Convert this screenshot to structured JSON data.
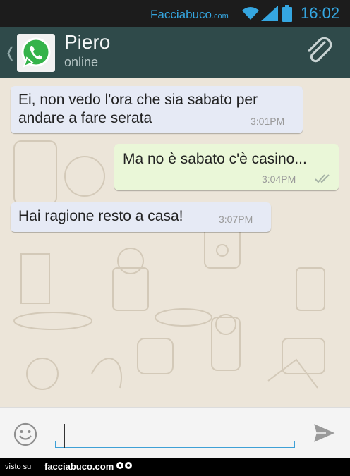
{
  "status_bar": {
    "brand": "Facciabuco",
    "brand_suffix": ".com",
    "time": "16:02"
  },
  "header": {
    "back_icon": "chevron-left-icon",
    "avatar_icon": "whatsapp-icon",
    "contact_name": "Piero",
    "contact_status": "online",
    "attach_icon": "paperclip-icon"
  },
  "messages": [
    {
      "direction": "incoming",
      "text_lines": [
        "Ei, non vedo l'ora che sia sabato per",
        "andare a fare serata"
      ],
      "time": "3:01PM"
    },
    {
      "direction": "outgoing",
      "text_lines": [
        "Ma no è sabato c'è casino..."
      ],
      "time": "3:04PM",
      "status_icon": "double-check-icon"
    },
    {
      "direction": "incoming",
      "text_lines": [
        "Hai ragione resto a casa!"
      ],
      "time": "3:07PM"
    }
  ],
  "composer": {
    "value": "",
    "emoji_icon": "smiley-icon",
    "send_icon": "send-icon"
  },
  "footer": {
    "prefix": "visto su",
    "site": "facciabuco.com"
  },
  "colors": {
    "status_bar": "#1c1c1c",
    "brand_blue": "#35a6e0",
    "action_bar": "#2f4a4a",
    "chat_bg": "#ece5d9",
    "incoming_bubble": "#e6eaf5",
    "outgoing_bubble": "#eaf7d8",
    "input_underline": "#3ea0d6"
  }
}
